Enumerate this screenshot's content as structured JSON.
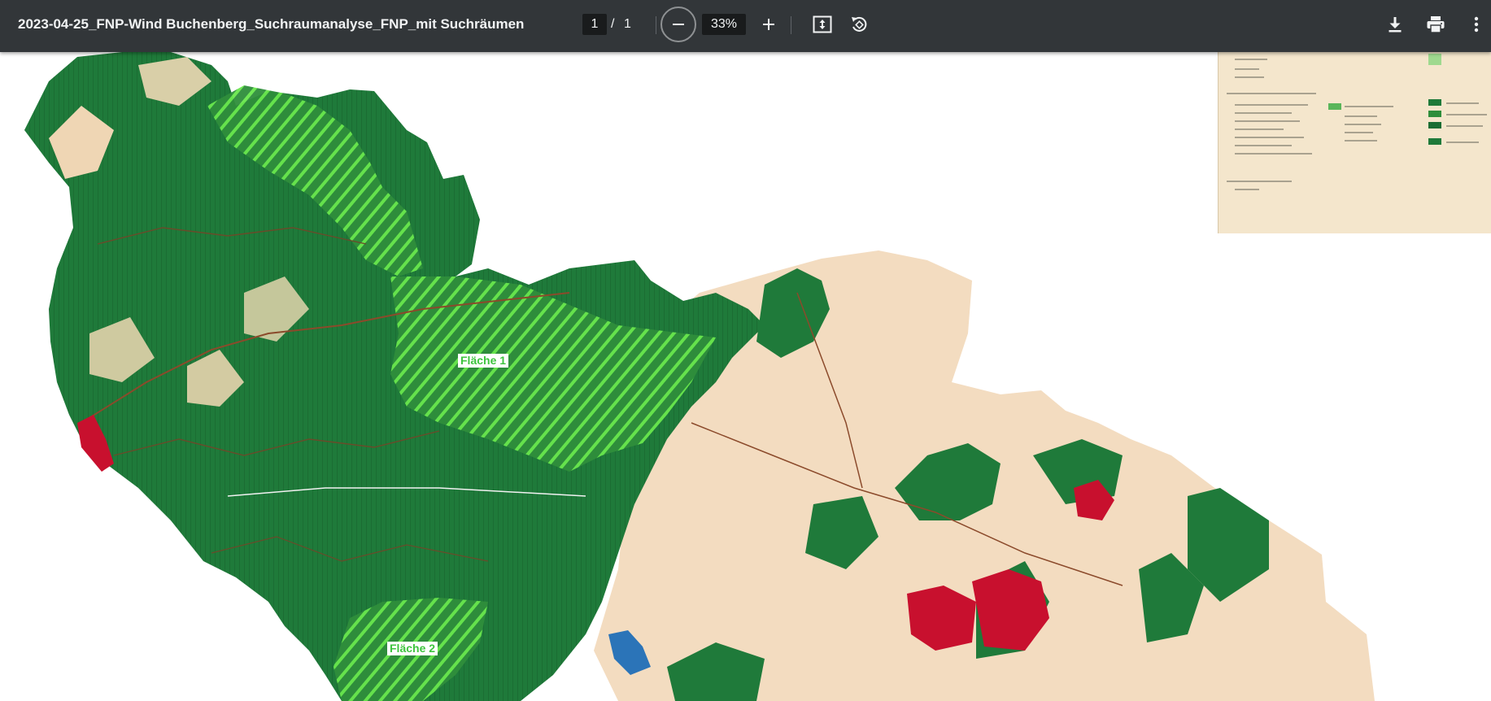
{
  "document": {
    "title": "2023-04-25_FNP-Wind Buchenberg_Suchraumanalyse_FNP_mit Suchräumen"
  },
  "pager": {
    "current": "1",
    "separator": "/",
    "total": "1"
  },
  "zoom": {
    "value": "33%"
  },
  "map": {
    "labels": {
      "area1": "Fläche 1",
      "area2": "Fläche 2"
    }
  },
  "colors": {
    "toolbar_bg": "#323639",
    "forest_green": "#1f7a3a",
    "hatch_green": "#57e43d",
    "settlement_red": "#c8102e",
    "farmland_beige": "#f3dcc0",
    "water_blue": "#2b74b8"
  },
  "icons": {
    "zoom_out": "minus-icon",
    "zoom_in": "plus-icon",
    "fit": "fit-page-icon",
    "rotate": "rotate-icon",
    "download": "download-icon",
    "print": "print-icon",
    "more": "more-vert-icon"
  }
}
